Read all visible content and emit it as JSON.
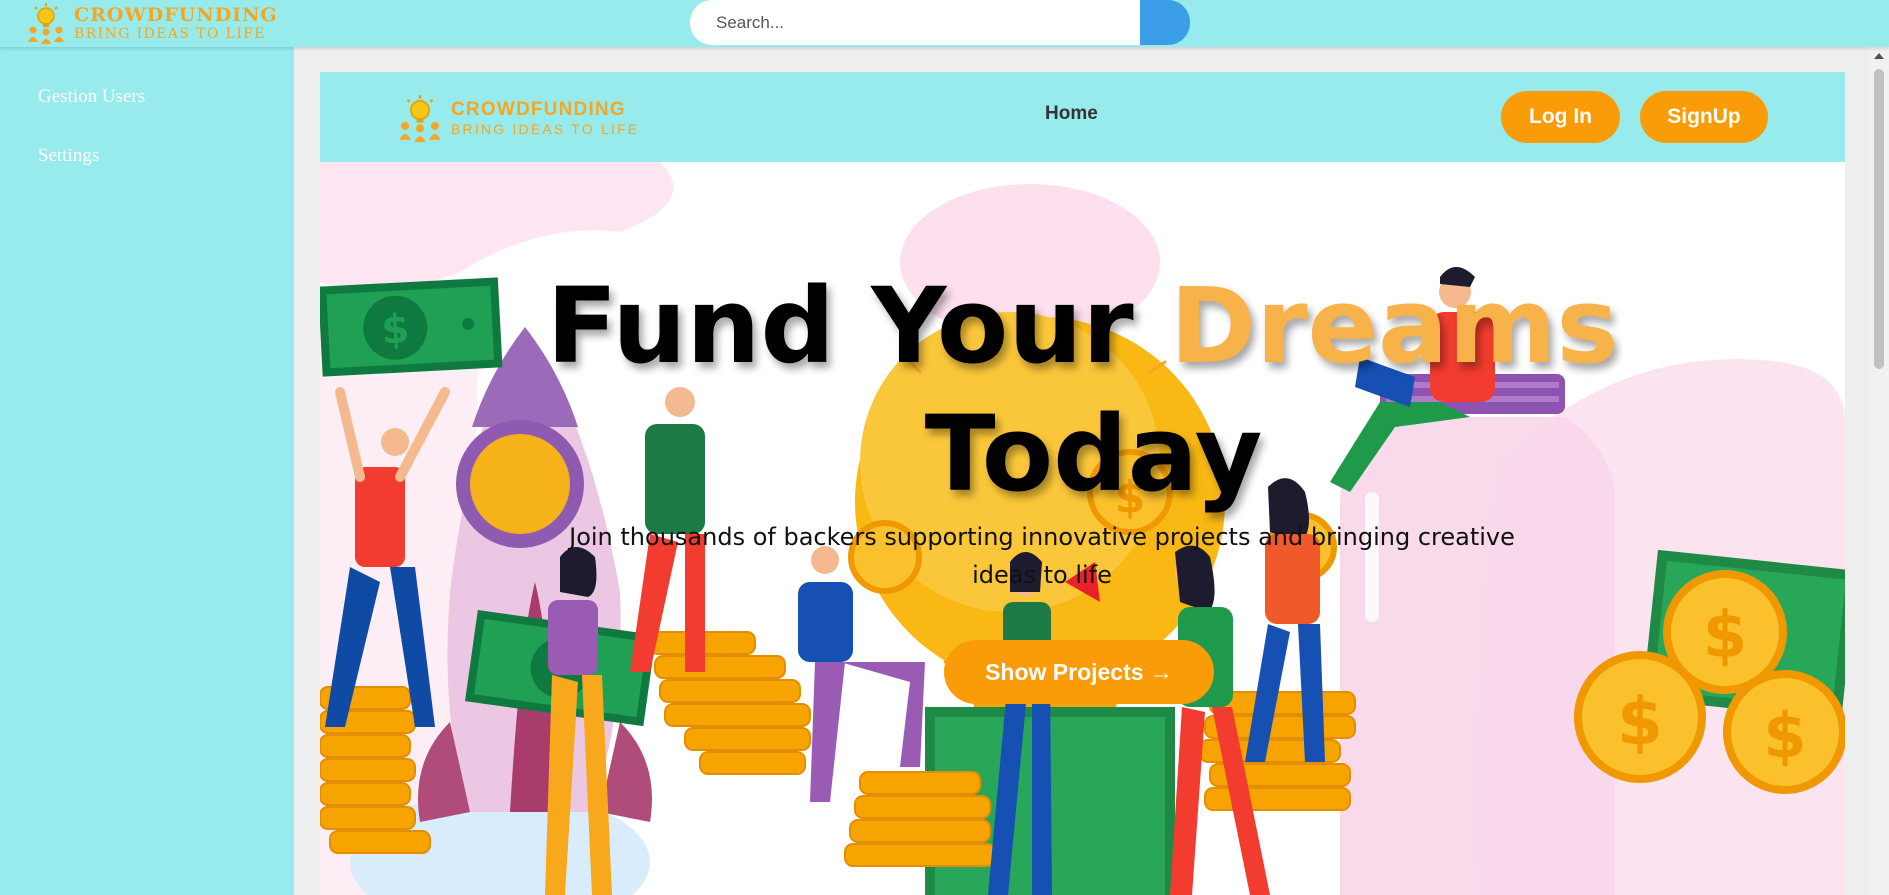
{
  "app": {
    "brand_title": "CROWDFUNDING",
    "brand_tagline": "BRING IDEAS TO LIFE"
  },
  "search": {
    "placeholder": "Search..."
  },
  "sidebar": {
    "items": [
      {
        "label": "Gestion Users"
      },
      {
        "label": "Settings"
      }
    ]
  },
  "nav": {
    "brand_title": "CROWDFUNDING",
    "brand_tagline": "BRING IDEAS TO LIFE",
    "links": [
      {
        "label": "Home"
      }
    ],
    "login_label": "Log In",
    "signup_label": "SignUp"
  },
  "hero": {
    "title_part1": "Fund Your ",
    "title_highlight": "Dreams",
    "title_part2": "Today",
    "subtitle": "Join thousands of backers supporting innovative projects and bringing creative ideas to life",
    "cta_label": "Show Projects →"
  },
  "colors": {
    "topbar": "#98ebec",
    "accent_orange": "#fa9b08",
    "brand_gold": "#f5a623",
    "highlight": "#f7b24a",
    "search_button": "#3b9ee6"
  },
  "icons": {
    "logo": "lightbulb-people-logo-icon",
    "search": "search-icon"
  }
}
